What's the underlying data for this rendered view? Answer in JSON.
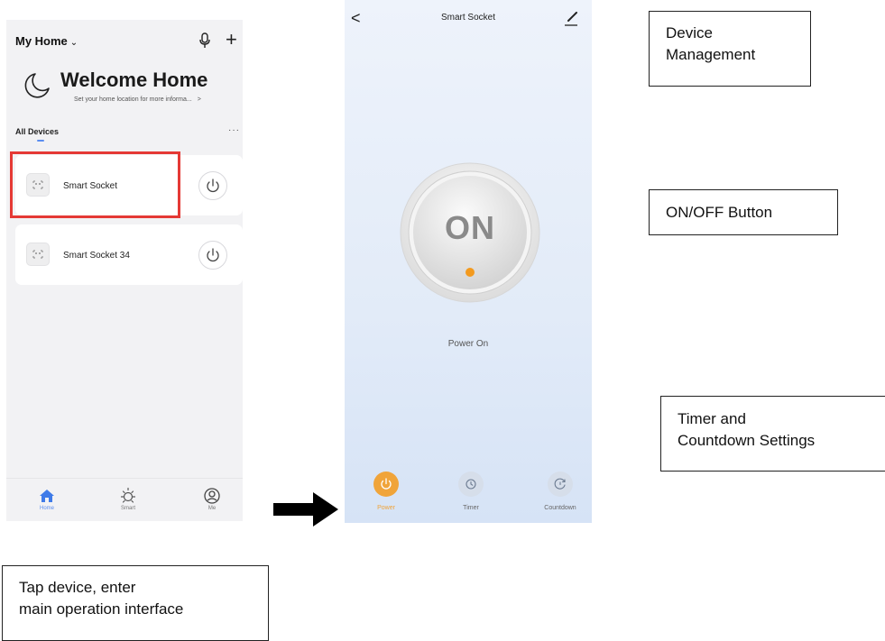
{
  "home_screen": {
    "home_selector": "My Home",
    "welcome_title": "Welcome Home",
    "welcome_subtitle": "Set your home location for more informa...",
    "welcome_chevron": ">",
    "section_title": "All Devices",
    "more_menu": "···",
    "add_symbol": "+",
    "devices": [
      {
        "name": "Smart Socket"
      },
      {
        "name": "Smart Socket 34"
      }
    ],
    "tabs": [
      {
        "label": "Home",
        "icon": "home-icon"
      },
      {
        "label": "Smart",
        "icon": "sun-icon"
      },
      {
        "label": "Me",
        "icon": "user-icon"
      }
    ]
  },
  "device_screen": {
    "back": "<",
    "title": "Smart Socket",
    "main_button_text": "ON",
    "status": "Power On",
    "tabs": [
      {
        "label": "Power",
        "icon": "power-icon"
      },
      {
        "label": "Timer",
        "icon": "timer-icon"
      },
      {
        "label": "Countdown",
        "icon": "countdown-icon"
      }
    ]
  },
  "callouts": {
    "device_management": [
      "Device",
      "Management"
    ],
    "on_off": "ON/OFF Button",
    "timer": [
      "Timer and",
      "Countdown Settings"
    ],
    "tap_device": [
      "Tap device, enter",
      "main operation interface"
    ]
  },
  "colors": {
    "highlight_red": "#e53935",
    "accent_blue": "#5b8ef0",
    "power_orange": "#f0a43a"
  }
}
